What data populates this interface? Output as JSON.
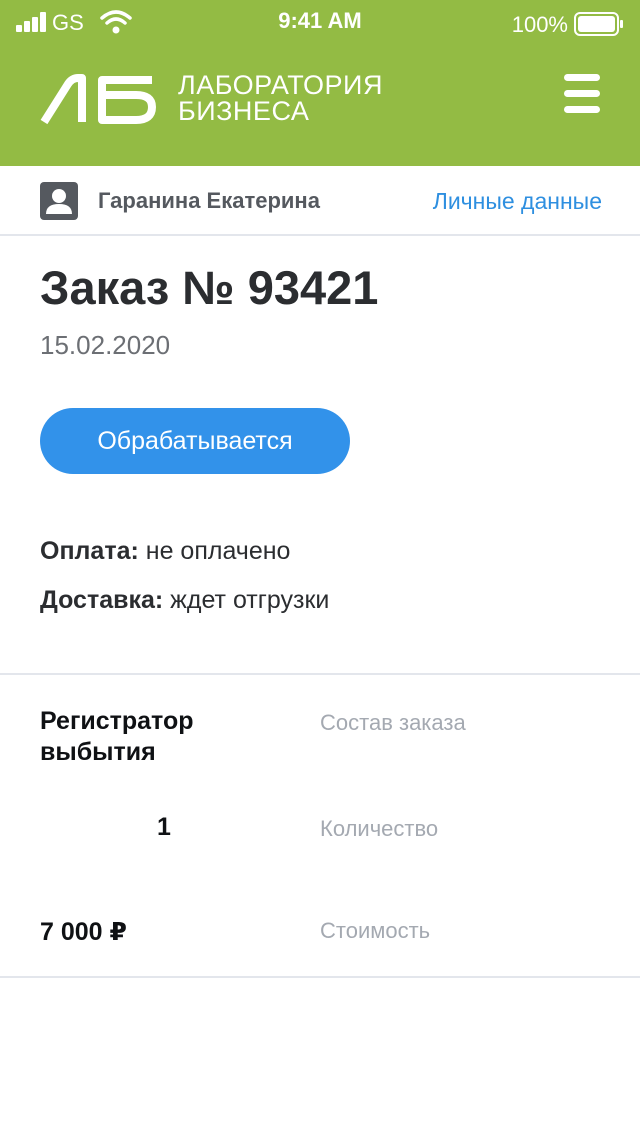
{
  "status_bar": {
    "carrier": "GS",
    "time": "9:41 AM",
    "battery": "100%",
    "icons": [
      "signal-bars-icon",
      "wifi-icon",
      "battery-icon"
    ]
  },
  "header": {
    "logo_mark": "ЛБ",
    "logo_line1": "ЛАБОРАТОРИЯ",
    "logo_line2": "БИЗНЕСА",
    "menu_icon": "hamburger-menu-icon",
    "background_color": "#93bb44"
  },
  "user": {
    "avatar_icon": "user-avatar-icon",
    "name": "Гаранина Екатерина",
    "personal_data_link": "Личные данные",
    "link_color": "#2e8fe0"
  },
  "order": {
    "title": "Заказ № 93421",
    "date": "15.02.2020",
    "status": "Обрабатывается",
    "status_color": "#3292ea",
    "payment_label": "Оплата:",
    "payment_value": "не оплачено",
    "delivery_label": "Доставка:",
    "delivery_value": "ждет отгрузки"
  },
  "composition": {
    "product_name": "Регистратор выбытия",
    "product_label": "Состав заказа",
    "quantity": "1",
    "quantity_label": "Количество",
    "price": "7 000 ₽",
    "price_label": "Стоимость"
  }
}
